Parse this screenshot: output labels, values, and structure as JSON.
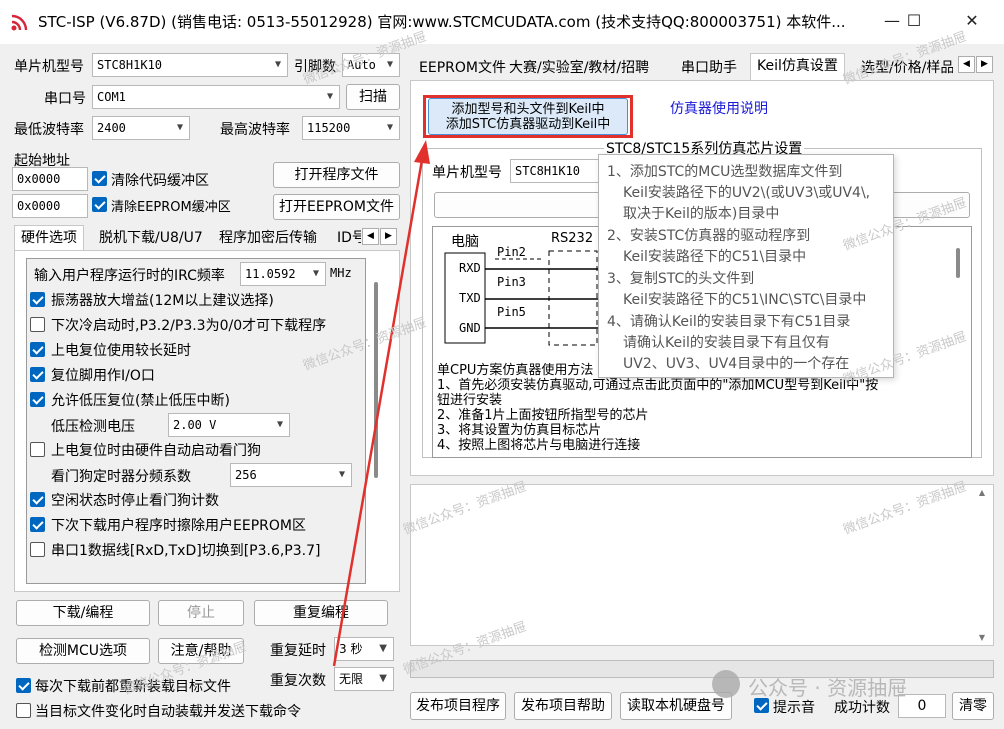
{
  "window": {
    "title": "STC-ISP (V6.87D) (销售电话: 0513-55012928) 官网:www.STCMCUDATA.com  (技术支持QQ:800003751) 本软件...",
    "minimize": "—",
    "maximize": "☐",
    "close": "✕"
  },
  "left": {
    "mcu_label": "单片机型号",
    "mcu_value": "STC8H1K10",
    "pins_label": "引脚数",
    "pins_value": "Auto",
    "port_label": "串口号",
    "port_value": "COM1",
    "scan_button": "扫描",
    "min_baud_label": "最低波特率",
    "min_baud_value": "2400",
    "max_baud_label": "最高波特率",
    "max_baud_value": "115200",
    "start_addr_label": "起始地址",
    "addr1_value": "0x0000",
    "clear_code_label": "清除代码缓冲区",
    "open_program_button": "打开程序文件",
    "addr2_value": "0x0000",
    "clear_eeprom_label": "清除EEPROM缓冲区",
    "open_eeprom_button": "打开EEPROM文件",
    "tabs": [
      "硬件选项",
      "脱机下载/U8/U7",
      "程序加密后传输",
      "ID号"
    ],
    "irc_label": "输入用户程序运行时的IRC频率",
    "irc_value": "11.0592",
    "irc_unit": "MHz",
    "options": [
      {
        "label": "振荡器放大增益(12M以上建议选择)",
        "checked": true
      },
      {
        "label": "下次冷启动时,P3.2/P3.3为0/0才可下载程序",
        "checked": false
      },
      {
        "label": "上电复位使用较长延时",
        "checked": true
      },
      {
        "label": "复位脚用作I/O口",
        "checked": true
      },
      {
        "label": "允许低压复位(禁止低压中断)",
        "checked": true
      }
    ],
    "lowvolt_label": "低压检测电压",
    "lowvolt_value": "2.00 V",
    "watchdog_label": "上电复位时由硬件自动启动看门狗",
    "watchdog_checked": false,
    "wdt_div_label": "看门狗定时器分频系数",
    "wdt_div_value": "256",
    "options2": [
      {
        "label": "空闲状态时停止看门狗计数",
        "checked": true
      },
      {
        "label": "下次下载用户程序时擦除用户EEPROM区",
        "checked": true
      },
      {
        "label": "串口1数据线[RxD,TxD]切换到[P3.6,P3.7]",
        "checked": false
      }
    ],
    "download_button": "下载/编程",
    "stop_button": "停止",
    "reprogram_button": "重复编程",
    "detect_button": "检测MCU选项",
    "help_button": "注意/帮助",
    "repeat_delay_label": "重复延时",
    "repeat_delay_value": "3 秒",
    "repeat_count_label": "重复次数",
    "repeat_count_value": "无限",
    "reload_label": "每次下载前都重新装载目标文件",
    "reload_checked": true,
    "autoload_label": "当目标文件变化时自动装载并发送下载命令",
    "autoload_checked": false
  },
  "right": {
    "tabs": [
      "EEPROM文件",
      "大赛/实验室/教材/招聘",
      "串口助手",
      "Keil仿真设置",
      "选型/价格/样品"
    ],
    "add_keil_button_line1": "添加型号和头文件到Keil中",
    "add_keil_button_line2": "添加STC仿真器驱动到Keil中",
    "emulator_help_link": "仿真器使用说明",
    "group_title": "STC8/STC15系列仿真芯片设置",
    "mcu_label": "单片机型号",
    "mcu_value": "STC8H1K10",
    "set_button_partial": "将",
    "diagram": {
      "pc_label": "电脑",
      "rs232_label": "RS232",
      "rxd": "RXD",
      "txd": "TXD",
      "gnd": "GND",
      "pin2": "Pin2",
      "pin3": "Pin3",
      "pin5": "Pin5"
    },
    "instructions": [
      "单CPU方案仿真器使用方法",
      "1、首先必须安装仿真驱动,可通过点击此页面中的\"添加MCU型号到Keil中\"按",
      "钮进行安装",
      "2、准备1片上面按钮所指型号的芯片",
      "3、将其设置为仿真目标芯片",
      "4、按照上图将芯片与电脑进行连接"
    ],
    "tooltip": [
      "1、添加STC的MCU选型数据库文件到",
      "Keil安装路径下的UV2\\(或UV3\\或UV4\\,",
      "取决于Keil的版本)目录中",
      "2、安装STC仿真器的驱动程序到",
      "Keil安装路径下的C51\\目录中",
      "3、复制STC的头文件到",
      "Keil安装路径下的C51\\INC\\STC\\目录中",
      "4、请确认Keil的安装目录下有C51目录",
      "请确认Keil的安装目录下有且仅有",
      "UV2、UV3、UV4目录中的一个存在"
    ],
    "publish_program_button": "发布项目程序",
    "publish_help_button": "发布项目帮助",
    "read_disk_button": "读取本机硬盘号",
    "tone_label": "提示音",
    "tone_checked": true,
    "success_count_label": "成功计数",
    "success_count_value": "0",
    "clear_button": "清零"
  },
  "watermarks": [
    "微信公众号：资源抽屉",
    "公众号 · 资源抽屉"
  ],
  "colors": {
    "highlight_red": "#e0312d",
    "link_blue": "#1a1ad8",
    "check_blue": "#0067c0"
  }
}
